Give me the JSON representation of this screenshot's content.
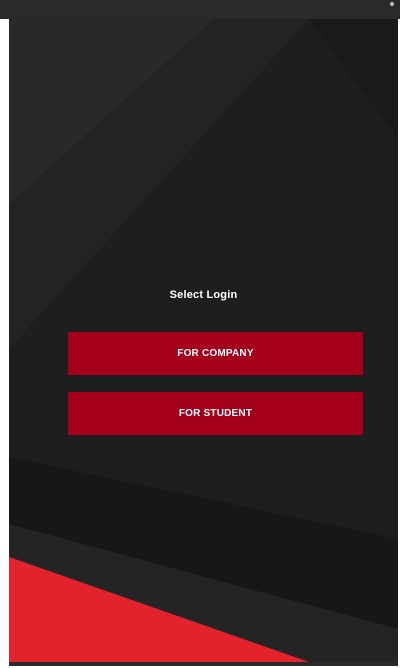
{
  "screen": {
    "title": "Select Login",
    "buttons": {
      "company_label": "FOR COMPANY",
      "student_label": "FOR STUDENT"
    }
  },
  "colors": {
    "background": "#1f1f1f",
    "button": "#a4001c",
    "accent_red": "#e3232c",
    "text": "#ffffff"
  }
}
